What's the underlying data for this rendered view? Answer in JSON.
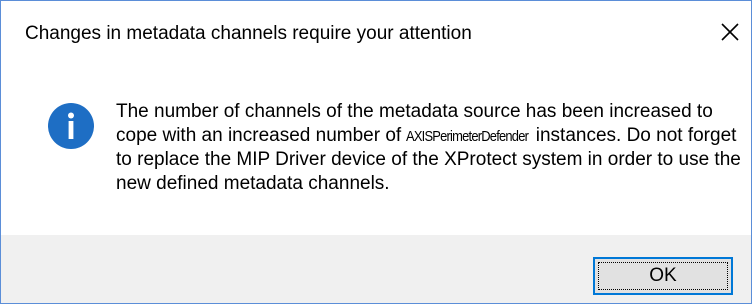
{
  "dialog": {
    "title": "Changes in metadata channels require your attention",
    "close_icon": "close-icon",
    "message": {
      "part1": "The number of channels of the metadata source has been increased to cope with an increased number of ",
      "highlight": "AXISPerimeterDefender",
      "part2": " instances. Do not forget to replace the MIP Driver device of the XProtect system in order to use the new defined metadata channels."
    },
    "icon": "info-icon",
    "ok_label": "OK"
  },
  "colors": {
    "border": "#5b8ed8",
    "info_icon": "#1e6ec4",
    "footer_bg": "#f0f0f0",
    "button_bg": "#e1e1e1",
    "button_focus_border": "#0078d7"
  }
}
